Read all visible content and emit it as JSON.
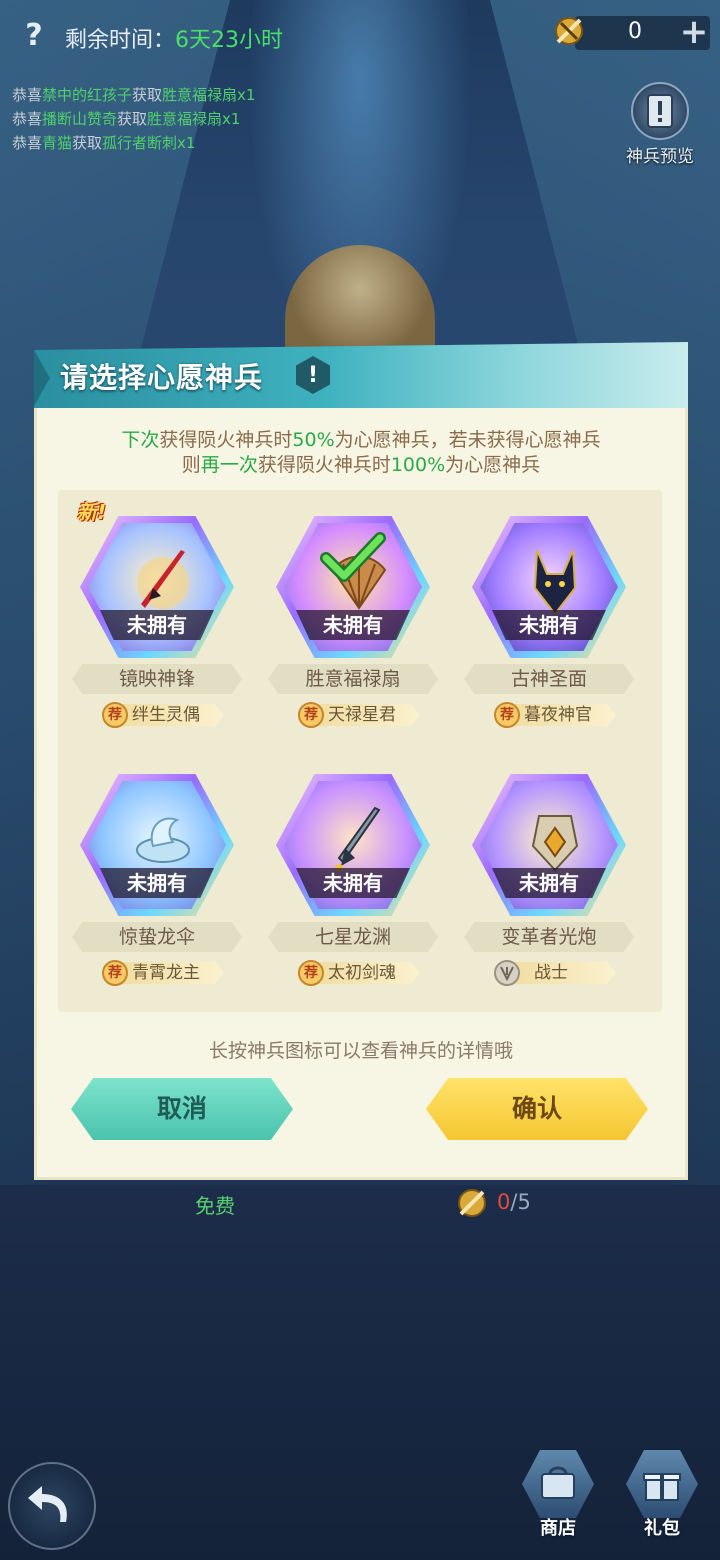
{
  "topbar": {
    "help": "?",
    "time_label": "剩余时间：",
    "time_value": "6天23小时",
    "currency_value": "0",
    "plus": "+"
  },
  "news": [
    {
      "prefix": "恭喜",
      "name": "禁中的红孩子",
      "verb": "获取",
      "item": "胜意福禄扇x1"
    },
    {
      "prefix": "恭喜",
      "name": "播断山赞奇",
      "verb": "获取",
      "item": "胜意福禄扇x1"
    },
    {
      "prefix": "恭喜",
      "name": "青猫",
      "verb": "获取",
      "item": "孤行者断刺x1"
    }
  ],
  "preview": {
    "label": "神兵预览"
  },
  "dialog": {
    "title": "请选择心愿神兵",
    "info": "!",
    "tip1": {
      "a": "下次",
      "b": "获得陨火神兵时",
      "c": "50%",
      "d": "为心愿神兵，若未获得心愿神兵"
    },
    "tip2": {
      "a": "则",
      "b": "再一次",
      "c": "获得陨火神兵时",
      "d": "100%",
      "e": "为心愿神兵"
    },
    "hint": "长按神兵图标可以查看神兵的详情哦",
    "cancel": "取消",
    "confirm": "确认"
  },
  "cards": [
    {
      "name": "镜映神锋",
      "status": "未拥有",
      "rec": "绊生灵偶",
      "rec_icon": "荐",
      "new": "新!"
    },
    {
      "name": "胜意福禄扇",
      "status": "未拥有",
      "rec": "天禄星君",
      "rec_icon": "荐",
      "selected": true
    },
    {
      "name": "古神圣面",
      "status": "未拥有",
      "rec": "暮夜神官",
      "rec_icon": "荐"
    },
    {
      "name": "惊蛰龙伞",
      "status": "未拥有",
      "rec": "青霄龙主",
      "rec_icon": "荐"
    },
    {
      "name": "七星龙渊",
      "status": "未拥有",
      "rec": "太初剑魂",
      "rec_icon": "荐"
    },
    {
      "name": "变革者光炮",
      "status": "未拥有",
      "rec": "战士",
      "rec_icon": "warrior-class-icon"
    }
  ],
  "bottom": {
    "free": "免费",
    "count_current": "0",
    "count_total": "/5",
    "shop": "商店",
    "gift": "礼包"
  },
  "colors": {
    "accent_green": "#49e06a",
    "header_teal": "#3fb2bf",
    "confirm_yellow": "#f4c631",
    "cancel_teal": "#4ac3ad"
  }
}
